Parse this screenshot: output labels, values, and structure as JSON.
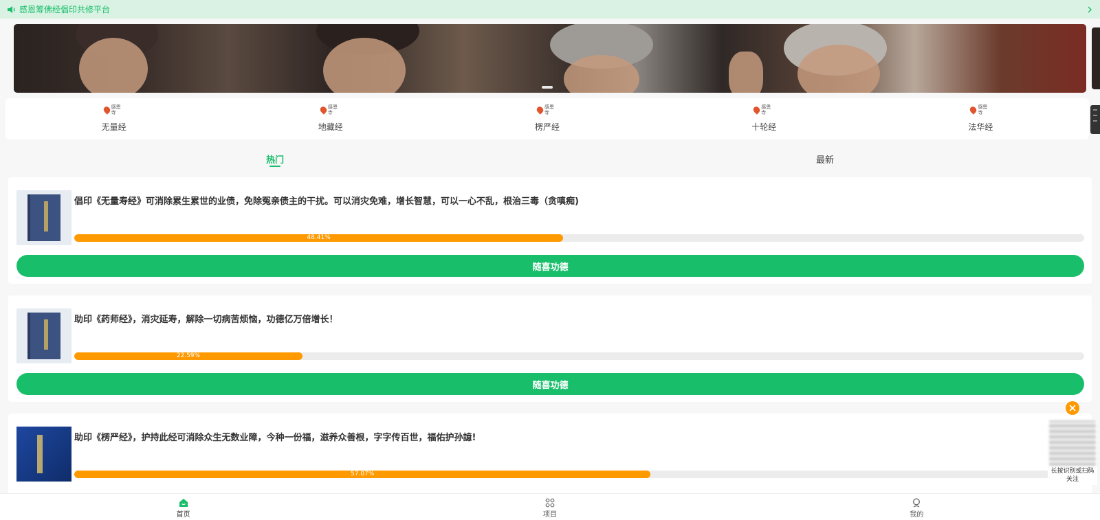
{
  "notice": {
    "text": "感恩筹佛经倡印共修平台",
    "icon": "speaker-icon"
  },
  "categories": [
    {
      "label": "无量经",
      "logo_text": "感恩寺"
    },
    {
      "label": "地藏经",
      "logo_text": "感恩寺"
    },
    {
      "label": "楞严经",
      "logo_text": "感恩寺"
    },
    {
      "label": "十轮经",
      "logo_text": "感恩寺"
    },
    {
      "label": "法华经",
      "logo_text": "感恩寺"
    }
  ],
  "tabs": [
    {
      "label": "热门",
      "active": true
    },
    {
      "label": "最新",
      "active": false
    }
  ],
  "projects": [
    {
      "title": "倡印《无量寿经》可消除累生累世的业债，免除冤亲债主的干扰。可以消灾免难，增长智慧，可以一心不乱，根治三毒（贪嗔痴)",
      "progress": 48.41,
      "progress_label": "48.41%",
      "button": "随喜功德"
    },
    {
      "title": "助印《药师经》，消灾延寿，解除一切病苦烦恼，功德亿万倍增长！",
      "progress": 22.59,
      "progress_label": "22.59%",
      "button": "随喜功德"
    },
    {
      "title": "助印《楞严经》，护持此经可消除众生无数业障，今种一份福，滋养众善根，字字传百世，福佑护孙譩!",
      "progress": 57.07,
      "progress_label": "57.07%"
    }
  ],
  "qr": {
    "caption_line1": "长按识别或扫码",
    "caption_line2": "关注"
  },
  "bottom_nav": [
    {
      "label": "首页",
      "icon": "home-icon",
      "active": true
    },
    {
      "label": "项目",
      "icon": "grid-icon",
      "active": false
    },
    {
      "label": "我的",
      "icon": "user-icon",
      "active": false
    }
  ],
  "colors": {
    "accent": "#19be6b",
    "progress": "#ff9900",
    "notice_bg": "#d9f2e3"
  }
}
